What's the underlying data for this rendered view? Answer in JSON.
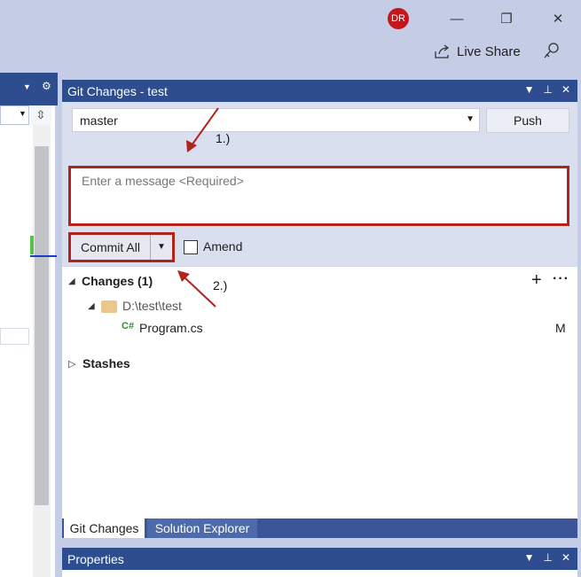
{
  "titlebar": {
    "avatar_initials": "DR",
    "minimize_glyph": "—",
    "restore_glyph": "❐",
    "close_glyph": "✕",
    "live_share": "Live Share"
  },
  "git_panel": {
    "title": "Git Changes - test",
    "branch": "master",
    "push_label": "Push",
    "message_placeholder": "Enter a message <Required>",
    "commit_label": "Commit All",
    "amend_label": "Amend",
    "changes_label": "Changes (1)",
    "folder_path": "D:\\test\\test",
    "file_icon_text": "C#",
    "file_name": "Program.cs",
    "file_status": "M",
    "stashes_label": "Stashes"
  },
  "annotations": {
    "step1": "1.)",
    "step2": "2.)",
    "arrow_color": "#b1241c"
  },
  "tabs": [
    "Git Changes",
    "Solution Explorer"
  ],
  "properties_panel": {
    "title": "Properties"
  },
  "colors": {
    "header_blue": "#2d4d8e",
    "highlight_red": "#b1241c",
    "chrome": "#c5cde6"
  }
}
